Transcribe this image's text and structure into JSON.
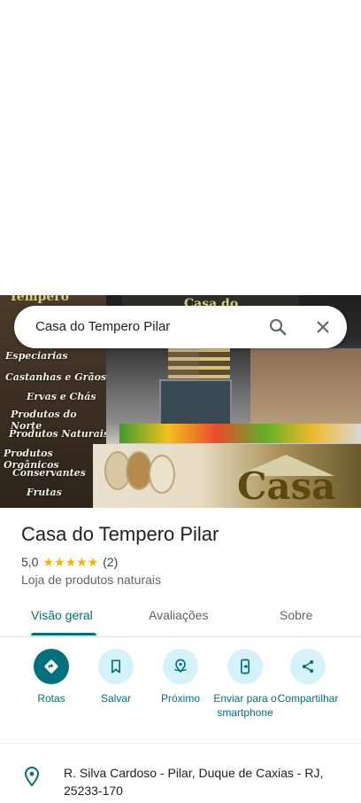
{
  "search": {
    "query": "Casa do Tempero Pilar"
  },
  "hero_photo": {
    "banner_lines": [
      "Especiarias",
      "Castanhas e Grãos",
      "Ervas e Chás",
      "Produtos do Norte",
      "Produtos Naturais",
      "Produtos Orgânicos",
      "Conservantes",
      "Frutas"
    ],
    "top_left_sign": "Tempero",
    "shop_sign": "Casa do",
    "store_logo": "Casa"
  },
  "place": {
    "name": "Casa do Tempero Pilar",
    "rating": "5,0",
    "stars": "★★★★★",
    "review_count": "(2)",
    "category": "Loja de produtos naturais"
  },
  "tabs": [
    "Visão geral",
    "Avaliações",
    "Sobre"
  ],
  "active_tab": "Visão geral",
  "actions": [
    {
      "label": "Rotas",
      "icon": "directions-icon"
    },
    {
      "label": "Salvar",
      "icon": "bookmark-icon"
    },
    {
      "label": "Próximo",
      "icon": "nearby-icon"
    },
    {
      "label": "Enviar para o smartphone",
      "icon": "send-to-phone-icon"
    },
    {
      "label": "Compartilhar",
      "icon": "share-icon"
    }
  ],
  "address": "R. Silva Cardoso - Pilar, Duque de Caxias - RJ, 25233-170",
  "colors": {
    "accent": "#00707c",
    "chip_bg": "#d5f2fb",
    "star": "#f5b400"
  }
}
